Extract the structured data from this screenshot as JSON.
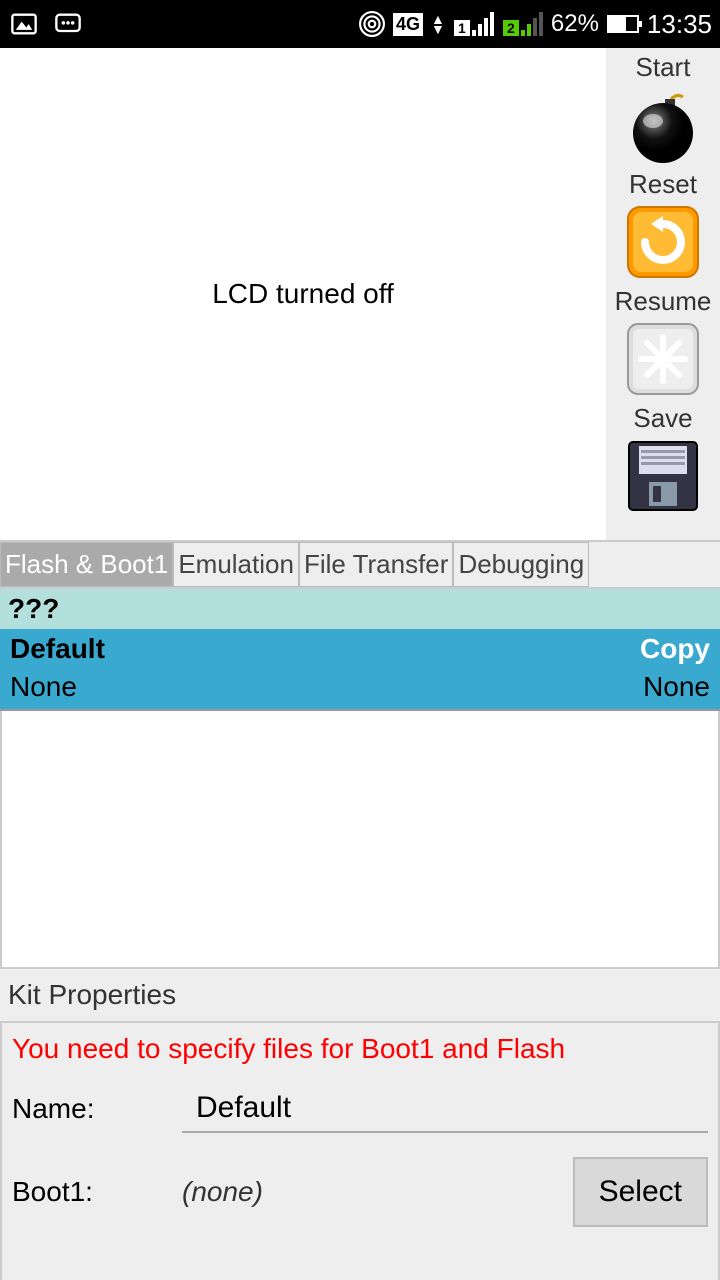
{
  "status": {
    "network": "4G",
    "battery_pct": "62%",
    "time": "13:35"
  },
  "lcd_message": "LCD turned off",
  "side_buttons": {
    "start": "Start",
    "reset": "Reset",
    "resume": "Resume",
    "save": "Save"
  },
  "tabs": {
    "flash": "Flash & Boot1",
    "emulation": "Emulation",
    "file_transfer": "File Transfer",
    "debugging": "Debugging"
  },
  "section_header": "???",
  "item": {
    "name": "Default",
    "copy_label": "Copy",
    "flash_value": "None",
    "boot_value": "None"
  },
  "kit": {
    "title": "Kit Properties",
    "warning": "You need to specify files for Boot1 and Flash",
    "name_label": "Name:",
    "name_value": "Default",
    "boot1_label": "Boot1:",
    "boot1_value": "(none)",
    "select_label": "Select"
  }
}
